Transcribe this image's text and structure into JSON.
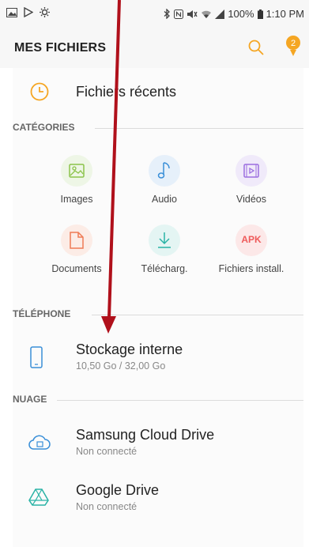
{
  "status_bar": {
    "icons_left": [
      "image-icon",
      "play-store-icon",
      "settings-icon"
    ],
    "icons_right": [
      "bluetooth-icon",
      "nfc-icon",
      "mute-icon",
      "wifi-icon",
      "signal-icon"
    ],
    "battery": "100%",
    "time": "1:10 PM"
  },
  "header": {
    "title": "MES FICHIERS",
    "notification_count": "2"
  },
  "recent": {
    "label": "Fichiers récents"
  },
  "categories": {
    "heading": "CATÉGORIES",
    "items": [
      {
        "label": "Images",
        "icon": "image-icon",
        "color": "#8bc34a"
      },
      {
        "label": "Audio",
        "icon": "music-note-icon",
        "color": "#3a8fd8"
      },
      {
        "label": "Vidéos",
        "icon": "video-icon",
        "color": "#9c6ee0"
      },
      {
        "label": "Documents",
        "icon": "document-icon",
        "color": "#ef7b55"
      },
      {
        "label": "Télécharg.",
        "icon": "download-icon",
        "color": "#2ab3a6"
      },
      {
        "label": "Fichiers install.",
        "icon": "apk-icon",
        "apk_text": "APK",
        "color": "#ef5b5b"
      }
    ]
  },
  "phone": {
    "heading": "TÉLÉPHONE",
    "storage_name": "Stockage interne",
    "storage_usage": "10,50 Go / 32,00 Go"
  },
  "cloud": {
    "heading": "NUAGE",
    "items": [
      {
        "name": "Samsung Cloud Drive",
        "status": "Non connecté"
      },
      {
        "name": "Google Drive",
        "status": "Non connecté"
      }
    ]
  },
  "colors": {
    "accent_orange": "#f5a623",
    "annotation_arrow": "#b0101b"
  }
}
